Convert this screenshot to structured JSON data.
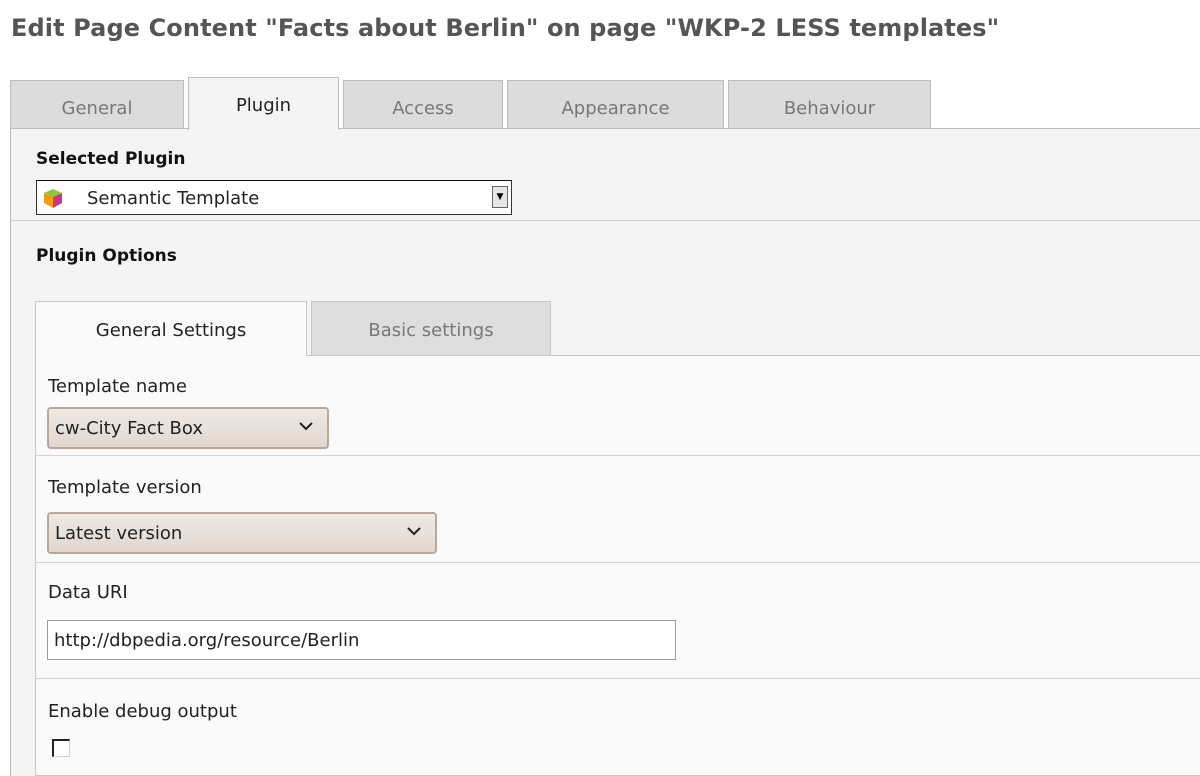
{
  "page_title": "Edit Page Content \"Facts about Berlin\" on page \"WKP-2 LESS templates\"",
  "main_tabs": [
    {
      "label": "General",
      "active": false
    },
    {
      "label": "Plugin",
      "active": true
    },
    {
      "label": "Access",
      "active": false
    },
    {
      "label": "Appearance",
      "active": false
    },
    {
      "label": "Behaviour",
      "active": false
    }
  ],
  "selected_plugin": {
    "label": "Selected Plugin",
    "value": "Semantic Template",
    "icon": "plugin-cube-icon"
  },
  "plugin_options": {
    "label": "Plugin Options",
    "tabs": [
      {
        "label": "General Settings",
        "active": true
      },
      {
        "label": "Basic settings",
        "active": false
      }
    ]
  },
  "fields": {
    "template_name": {
      "label": "Template name",
      "value": "cw-City Fact Box"
    },
    "template_version": {
      "label": "Template version",
      "value": "Latest version"
    },
    "data_uri": {
      "label": "Data URI",
      "value": "http://dbpedia.org/resource/Berlin"
    },
    "debug_output": {
      "label": "Enable debug output",
      "checked": false
    }
  }
}
